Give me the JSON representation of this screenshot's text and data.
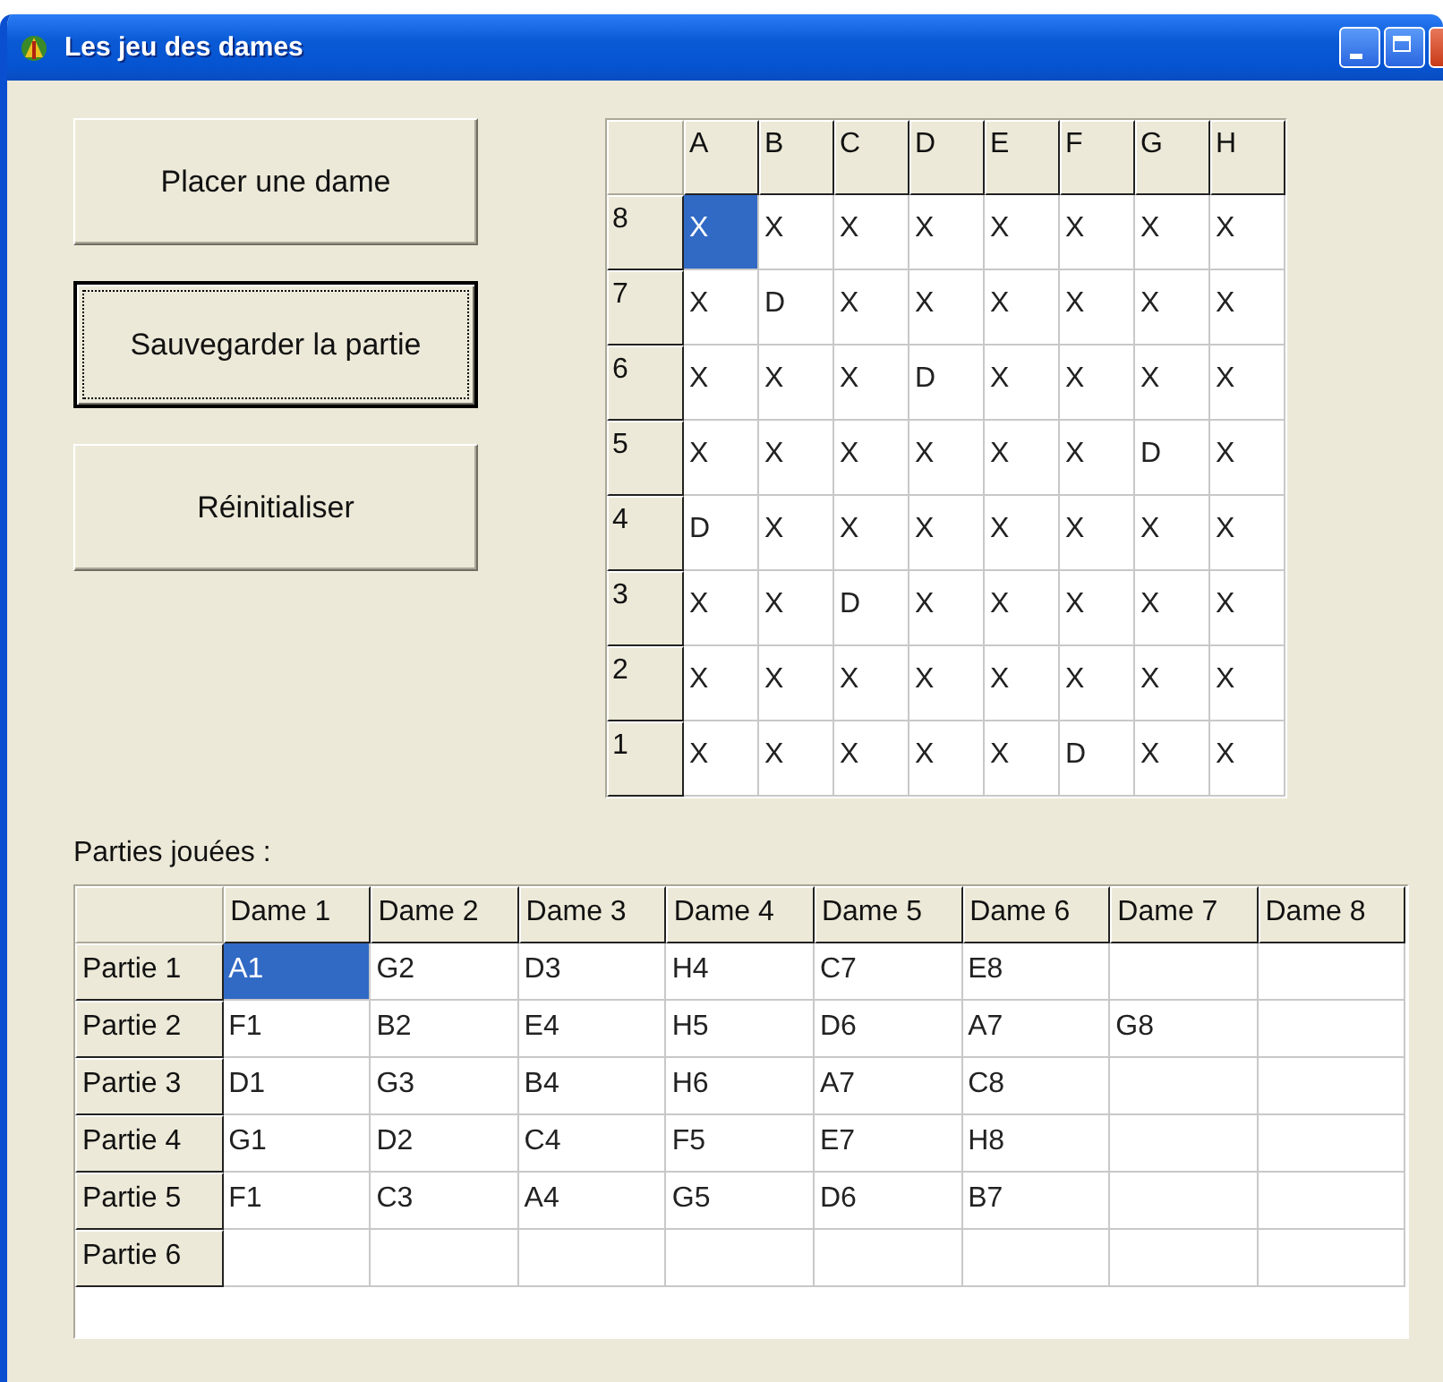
{
  "window": {
    "title": "Les jeu des dames"
  },
  "buttons": [
    {
      "label": "Placer une dame",
      "focused": false
    },
    {
      "label": "Sauvegarder la partie",
      "focused": true
    },
    {
      "label": "Réinitialiser",
      "focused": false
    }
  ],
  "board": {
    "columns": [
      "A",
      "B",
      "C",
      "D",
      "E",
      "F",
      "G",
      "H"
    ],
    "rows": [
      {
        "label": "8",
        "cells": [
          {
            "text": "X",
            "selected": true
          },
          {
            "text": "X",
            "selected": false
          },
          {
            "text": "X",
            "selected": false
          },
          {
            "text": "X",
            "selected": false
          },
          {
            "text": "X",
            "selected": false
          },
          {
            "text": "X",
            "selected": false
          },
          {
            "text": "X",
            "selected": false
          },
          {
            "text": "X",
            "selected": false
          }
        ]
      },
      {
        "label": "7",
        "cells": [
          {
            "text": "X",
            "selected": false
          },
          {
            "text": "D",
            "selected": false
          },
          {
            "text": "X",
            "selected": false
          },
          {
            "text": "X",
            "selected": false
          },
          {
            "text": "X",
            "selected": false
          },
          {
            "text": "X",
            "selected": false
          },
          {
            "text": "X",
            "selected": false
          },
          {
            "text": "X",
            "selected": false
          }
        ]
      },
      {
        "label": "6",
        "cells": [
          {
            "text": "X",
            "selected": false
          },
          {
            "text": "X",
            "selected": false
          },
          {
            "text": "X",
            "selected": false
          },
          {
            "text": "D",
            "selected": false
          },
          {
            "text": "X",
            "selected": false
          },
          {
            "text": "X",
            "selected": false
          },
          {
            "text": "X",
            "selected": false
          },
          {
            "text": "X",
            "selected": false
          }
        ]
      },
      {
        "label": "5",
        "cells": [
          {
            "text": "X",
            "selected": false
          },
          {
            "text": "X",
            "selected": false
          },
          {
            "text": "X",
            "selected": false
          },
          {
            "text": "X",
            "selected": false
          },
          {
            "text": "X",
            "selected": false
          },
          {
            "text": "X",
            "selected": false
          },
          {
            "text": "D",
            "selected": false
          },
          {
            "text": "X",
            "selected": false
          }
        ]
      },
      {
        "label": "4",
        "cells": [
          {
            "text": "D",
            "selected": false
          },
          {
            "text": "X",
            "selected": false
          },
          {
            "text": "X",
            "selected": false
          },
          {
            "text": "X",
            "selected": false
          },
          {
            "text": "X",
            "selected": false
          },
          {
            "text": "X",
            "selected": false
          },
          {
            "text": "X",
            "selected": false
          },
          {
            "text": "X",
            "selected": false
          }
        ]
      },
      {
        "label": "3",
        "cells": [
          {
            "text": "X",
            "selected": false
          },
          {
            "text": "X",
            "selected": false
          },
          {
            "text": "D",
            "selected": false
          },
          {
            "text": "X",
            "selected": false
          },
          {
            "text": "X",
            "selected": false
          },
          {
            "text": "X",
            "selected": false
          },
          {
            "text": "X",
            "selected": false
          },
          {
            "text": "X",
            "selected": false
          }
        ]
      },
      {
        "label": "2",
        "cells": [
          {
            "text": "X",
            "selected": false
          },
          {
            "text": "X",
            "selected": false
          },
          {
            "text": "X",
            "selected": false
          },
          {
            "text": "X",
            "selected": false
          },
          {
            "text": "X",
            "selected": false
          },
          {
            "text": "X",
            "selected": false
          },
          {
            "text": "X",
            "selected": false
          },
          {
            "text": "X",
            "selected": false
          }
        ]
      },
      {
        "label": "1",
        "cells": [
          {
            "text": "X",
            "selected": false
          },
          {
            "text": "X",
            "selected": false
          },
          {
            "text": "X",
            "selected": false
          },
          {
            "text": "X",
            "selected": false
          },
          {
            "text": "X",
            "selected": false
          },
          {
            "text": "D",
            "selected": false
          },
          {
            "text": "X",
            "selected": false
          },
          {
            "text": "X",
            "selected": false
          }
        ]
      }
    ]
  },
  "games": {
    "label": "Parties jouées :",
    "columns": [
      "Dame 1",
      "Dame 2",
      "Dame 3",
      "Dame 4",
      "Dame 5",
      "Dame 6",
      "Dame 7",
      "Dame 8"
    ],
    "rows": [
      {
        "label": "Partie 1",
        "cells": [
          {
            "text": "A1",
            "selected": true
          },
          {
            "text": "G2",
            "selected": false
          },
          {
            "text": "D3",
            "selected": false
          },
          {
            "text": "H4",
            "selected": false
          },
          {
            "text": "C7",
            "selected": false
          },
          {
            "text": "E8",
            "selected": false
          },
          {
            "selected": false
          },
          {
            "selected": false
          }
        ]
      },
      {
        "label": "Partie 2",
        "cells": [
          {
            "text": "F1",
            "selected": false
          },
          {
            "text": "B2",
            "selected": false
          },
          {
            "text": "E4",
            "selected": false
          },
          {
            "text": "H5",
            "selected": false
          },
          {
            "text": "D6",
            "selected": false
          },
          {
            "text": "A7",
            "selected": false
          },
          {
            "text": "G8",
            "selected": false
          },
          {
            "selected": false
          }
        ]
      },
      {
        "label": "Partie 3",
        "cells": [
          {
            "text": "D1",
            "selected": false
          },
          {
            "text": "G3",
            "selected": false
          },
          {
            "text": "B4",
            "selected": false
          },
          {
            "text": "H6",
            "selected": false
          },
          {
            "text": "A7",
            "selected": false
          },
          {
            "text": "C8",
            "selected": false
          },
          {
            "selected": false
          },
          {
            "selected": false
          }
        ]
      },
      {
        "label": "Partie 4",
        "cells": [
          {
            "text": "G1",
            "selected": false
          },
          {
            "text": "D2",
            "selected": false
          },
          {
            "text": "C4",
            "selected": false
          },
          {
            "text": "F5",
            "selected": false
          },
          {
            "text": "E7",
            "selected": false
          },
          {
            "text": "H8",
            "selected": false
          },
          {
            "selected": false
          },
          {
            "selected": false
          }
        ]
      },
      {
        "label": "Partie 5",
        "cells": [
          {
            "text": "F1",
            "selected": false
          },
          {
            "text": "C3",
            "selected": false
          },
          {
            "text": "A4",
            "selected": false
          },
          {
            "text": "G5",
            "selected": false
          },
          {
            "text": "D6",
            "selected": false
          },
          {
            "text": "B7",
            "selected": false
          },
          {
            "selected": false
          },
          {
            "selected": false
          }
        ]
      },
      {
        "label": "Partie 6",
        "cells": [
          {
            "selected": false
          },
          {
            "selected": false
          },
          {
            "selected": false
          },
          {
            "selected": false
          },
          {
            "selected": false
          },
          {
            "selected": false
          },
          {
            "selected": false
          },
          {
            "selected": false
          }
        ]
      }
    ]
  }
}
